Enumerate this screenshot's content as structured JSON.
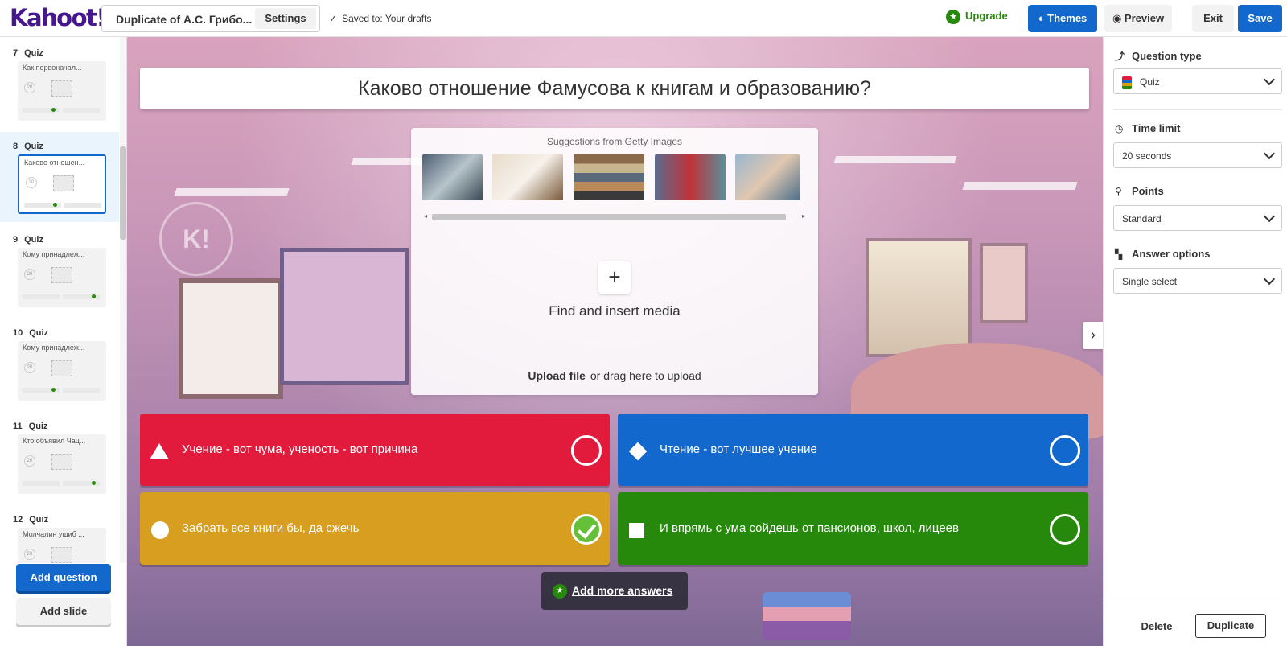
{
  "header": {
    "logo": "Kahoot!",
    "kahoot_title": "Duplicate of А.С. Грибо...",
    "settings_label": "Settings",
    "saved_status": "Saved to: Your drafts",
    "upgrade_label": "Upgrade",
    "themes_label": "Themes",
    "preview_label": "Preview",
    "exit_label": "Exit",
    "save_label": "Save"
  },
  "sidebar": {
    "slides": [
      {
        "num": "7",
        "type": "Quiz",
        "text": "Как первоначал...",
        "time": "20",
        "active": false
      },
      {
        "num": "8",
        "type": "Quiz",
        "text": "Каково отношен...",
        "time": "20",
        "active": true
      },
      {
        "num": "9",
        "type": "Quiz",
        "text": "Кому принадлеж...",
        "time": "20",
        "active": false
      },
      {
        "num": "10",
        "type": "Quiz",
        "text": "Кому принадлеж...",
        "time": "20",
        "active": false
      },
      {
        "num": "11",
        "type": "Quiz",
        "text": "Кто объявил Чац...",
        "time": "20",
        "active": false
      },
      {
        "num": "12",
        "type": "Quiz",
        "text": "Молчалин ушиб ...",
        "time": "20",
        "active": false
      }
    ],
    "add_question_label": "Add question",
    "add_slide_label": "Add slide"
  },
  "editor": {
    "question": "Каково отношение Фамусова к книгам и образованию?",
    "media": {
      "getty_label": "Suggestions from Getty Images",
      "find_label": "Find and insert media",
      "upload_link": "Upload file",
      "upload_hint": "or drag here to upload"
    },
    "answers": [
      {
        "text": "Учение - вот чума, ученость - вот причина",
        "color": "#e21b3c",
        "shape": "triangle",
        "correct": false
      },
      {
        "text": "Чтение - вот лучшее учение",
        "color": "#1368ce",
        "shape": "diamond",
        "correct": false
      },
      {
        "text": "Забрать все книги бы, да сжечь",
        "color": "#d89e00",
        "shape": "circle",
        "correct": true
      },
      {
        "text": "И впрямь с ума сойдешь от пансионов, школ, лицеев",
        "color": "#26890c",
        "shape": "square",
        "correct": false
      }
    ],
    "add_more_label": "Add more answers"
  },
  "right_panel": {
    "question_type_label": "Question type",
    "question_type_value": "Quiz",
    "time_limit_label": "Time limit",
    "time_limit_value": "20 seconds",
    "points_label": "Points",
    "points_value": "Standard",
    "answer_options_label": "Answer options",
    "answer_options_value": "Single select",
    "delete_label": "Delete",
    "duplicate_label": "Duplicate"
  }
}
